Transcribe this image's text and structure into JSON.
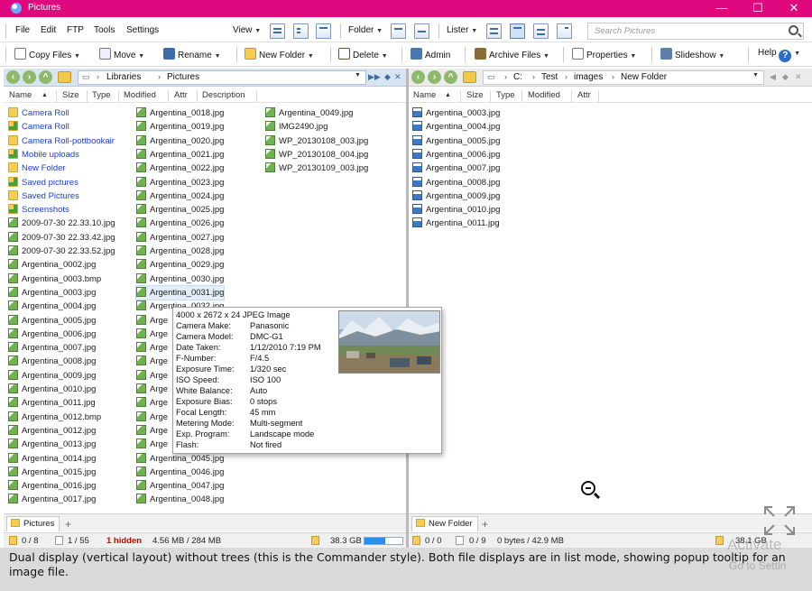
{
  "window": {
    "title": "Pictures",
    "controls": {
      "minimize": "—",
      "maximize": "☐",
      "close": "✕"
    }
  },
  "menu": [
    "File",
    "Edit",
    "FTP",
    "Tools",
    "Settings"
  ],
  "view_menu": {
    "view": "View",
    "folder": "Folder",
    "lister": "Lister"
  },
  "search": {
    "placeholder": "Search Pictures"
  },
  "toolbar": {
    "copy_files": "Copy Files",
    "move": "Move",
    "rename": "Rename",
    "new_folder": "New Folder",
    "delete": "Delete",
    "admin": "Admin",
    "archive_files": "Archive Files",
    "properties": "Properties",
    "slideshow": "Slideshow",
    "help": "Help"
  },
  "left_pane": {
    "breadcrumb": [
      "Libraries",
      "Pictures"
    ],
    "columns": [
      "Name",
      "Size",
      "Type",
      "Modified",
      "Attr",
      "Description"
    ],
    "col1": [
      {
        "name": "Camera Roll",
        "kind": "folder"
      },
      {
        "name": "Camera Roll",
        "kind": "folder-green"
      },
      {
        "name": "Camera Roll-pottbookair",
        "kind": "folder"
      },
      {
        "name": "Mobile uploads",
        "kind": "folder-green"
      },
      {
        "name": "New Folder",
        "kind": "folder"
      },
      {
        "name": "Saved pictures",
        "kind": "folder-green"
      },
      {
        "name": "Saved Pictures",
        "kind": "folder"
      },
      {
        "name": "Screenshots",
        "kind": "folder-green"
      },
      {
        "name": "2009-07-30 22.33.10.jpg",
        "kind": "img"
      },
      {
        "name": "2009-07-30 22.33.42.jpg",
        "kind": "img"
      },
      {
        "name": "2009-07-30 22.33.52.jpg",
        "kind": "img"
      },
      {
        "name": "Argentina_0002.jpg",
        "kind": "img"
      },
      {
        "name": "Argentina_0003.bmp",
        "kind": "img"
      },
      {
        "name": "Argentina_0003.jpg",
        "kind": "img"
      },
      {
        "name": "Argentina_0004.jpg",
        "kind": "img"
      },
      {
        "name": "Argentina_0005.jpg",
        "kind": "img"
      },
      {
        "name": "Argentina_0006.jpg",
        "kind": "img"
      },
      {
        "name": "Argentina_0007.jpg",
        "kind": "img"
      },
      {
        "name": "Argentina_0008.jpg",
        "kind": "img"
      },
      {
        "name": "Argentina_0009.jpg",
        "kind": "img"
      },
      {
        "name": "Argentina_0010.jpg",
        "kind": "img"
      },
      {
        "name": "Argentina_0011.jpg",
        "kind": "img"
      },
      {
        "name": "Argentina_0012.bmp",
        "kind": "img"
      },
      {
        "name": "Argentina_0012.jpg",
        "kind": "img"
      },
      {
        "name": "Argentina_0013.jpg",
        "kind": "img"
      },
      {
        "name": "Argentina_0014.jpg",
        "kind": "img"
      },
      {
        "name": "Argentina_0015.jpg",
        "kind": "img"
      },
      {
        "name": "Argentina_0016.jpg",
        "kind": "img"
      },
      {
        "name": "Argentina_0017.jpg",
        "kind": "img"
      }
    ],
    "col2_top": [
      "Argentina_0018.jpg",
      "Argentina_0019.jpg",
      "Argentina_0020.jpg",
      "Argentina_0021.jpg",
      "Argentina_0022.jpg",
      "Argentina_0023.jpg",
      "Argentina_0024.jpg",
      "Argentina_0025.jpg",
      "Argentina_0026.jpg",
      "Argentina_0027.jpg",
      "Argentina_0028.jpg",
      "Argentina_0029.jpg",
      "Argentina_0030.jpg",
      "Argentina_0031.jpg"
    ],
    "col2_partial": [
      "Argentina_0032.jpg",
      "Arge",
      "Arge",
      "Arge",
      "Arge",
      "Arge",
      "Arge",
      "Arge",
      "Arge",
      "Arge",
      "Arge"
    ],
    "col2_bottom": [
      "Argentina_0045.jpg",
      "Argentina_0046.jpg",
      "Argentina_0047.jpg",
      "Argentina_0048.jpg"
    ],
    "col3": [
      "Argentina_0049.jpg",
      "IMG2490.jpg",
      "WP_20130108_003.jpg",
      "WP_20130108_004.jpg",
      "WP_20130109_003.jpg"
    ],
    "selected": "Argentina_0031.jpg",
    "tab": "Pictures",
    "status": {
      "folders": "0 / 8",
      "files": "1 / 55",
      "hidden": "1 hidden",
      "size": "4.56 MB / 284 MB",
      "free": "38.3 GB",
      "drive_used_fraction": 0.55
    }
  },
  "right_pane": {
    "breadcrumb": [
      "C:",
      "Test",
      "images",
      "New Folder"
    ],
    "columns": [
      "Name",
      "Size",
      "Type",
      "Modified",
      "Attr"
    ],
    "files": [
      "Argentina_0003.jpg",
      "Argentina_0004.jpg",
      "Argentina_0005.jpg",
      "Argentina_0006.jpg",
      "Argentina_0007.jpg",
      "Argentina_0008.jpg",
      "Argentina_0009.jpg",
      "Argentina_0010.jpg",
      "Argentina_0011.jpg"
    ],
    "tab": "New Folder",
    "status": {
      "folders": "0 / 0",
      "files": "0 / 9",
      "size": "0 bytes / 42.9 MB",
      "free": "38.1 GB"
    }
  },
  "tooltip": {
    "header": "4000 x 2672 x 24 JPEG Image",
    "rows": [
      {
        "label": "Camera Make:",
        "value": "Panasonic"
      },
      {
        "label": "Camera Model:",
        "value": "DMC-G1"
      },
      {
        "label": "Date Taken:",
        "value": "1/12/2010 7:19 PM"
      },
      {
        "label": "F-Number:",
        "value": "F/4.5"
      },
      {
        "label": "Exposure Time:",
        "value": "1/320 sec"
      },
      {
        "label": "ISO Speed:",
        "value": "ISO 100"
      },
      {
        "label": "White Balance:",
        "value": "Auto"
      },
      {
        "label": "Exposure Bias:",
        "value": "0 stops"
      },
      {
        "label": "Focal Length:",
        "value": "45 mm"
      },
      {
        "label": "Metering Mode:",
        "value": "Multi-segment"
      },
      {
        "label": "Exp. Program:",
        "value": "Landscape mode"
      },
      {
        "label": "Flash:",
        "value": "Not fired"
      }
    ]
  },
  "caption": "Dual display (vertical layout) without trees (this is the Commander style). Both file displays are in list mode, showing popup tooltip for an image file.",
  "watermark": {
    "line1": "Activate",
    "line2": "Go to Settin"
  },
  "colors": {
    "titlebar": "#e0087e",
    "folder_link": "#1b40d6",
    "hidden": "#d40000",
    "addressbar": "#d9e4f1"
  }
}
